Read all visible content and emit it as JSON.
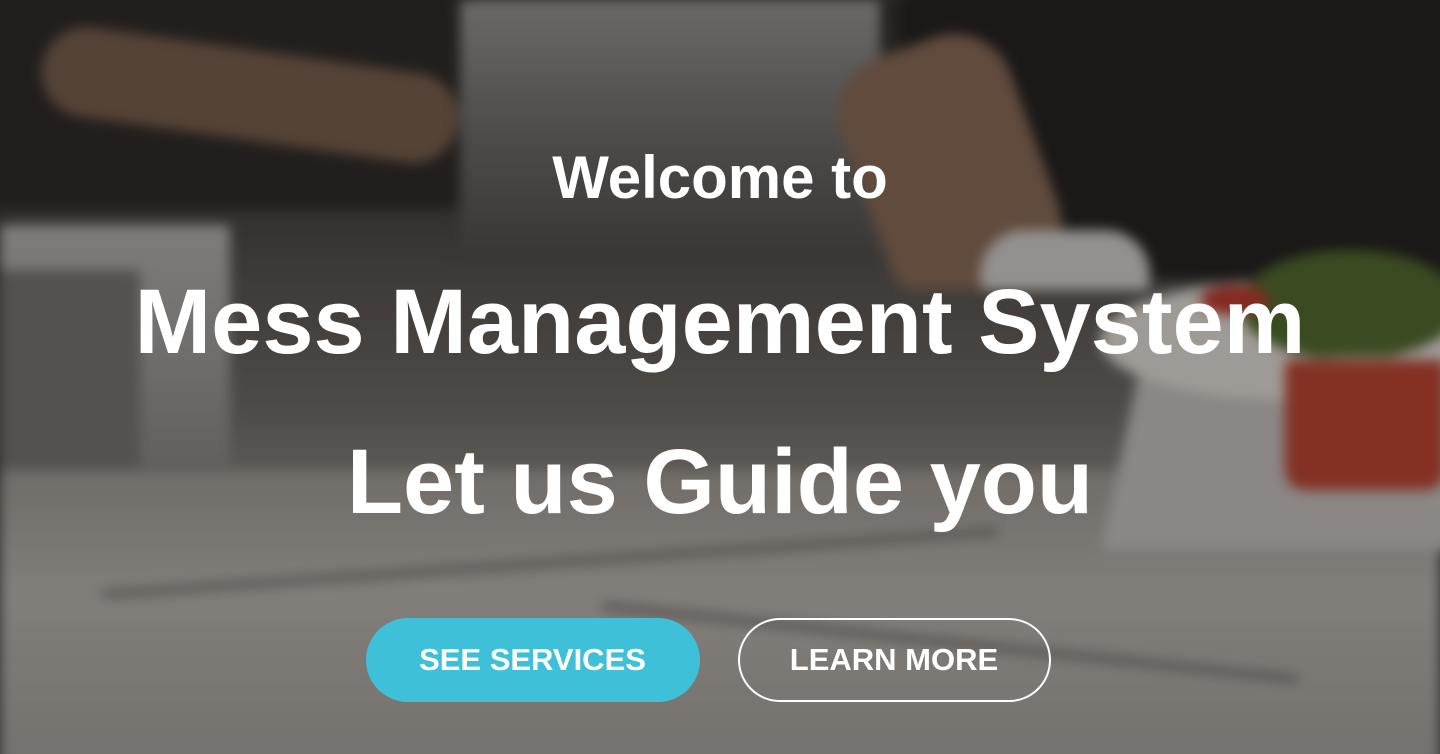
{
  "hero": {
    "welcome": "Welcome to",
    "title_line1": "Mess Management System",
    "title_line2": "Let us Guide you"
  },
  "actions": {
    "primary_label": "SEE SERVICES",
    "secondary_label": "LEARN MORE"
  },
  "colors": {
    "accent": "#3ec0d9",
    "text": "#ffffff"
  }
}
